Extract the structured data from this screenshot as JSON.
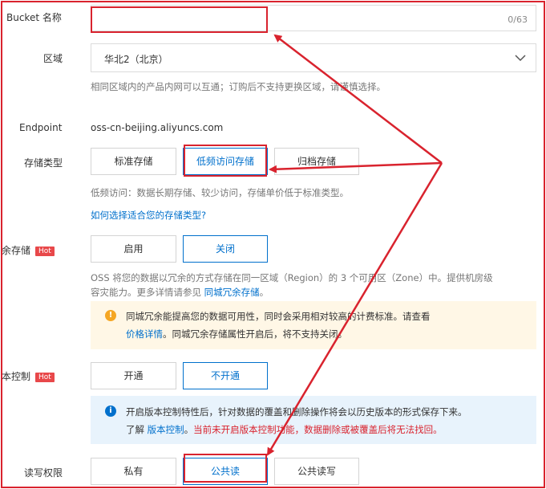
{
  "bucket": {
    "label": "Bucket 名称",
    "value": "",
    "counter": "0/63"
  },
  "region": {
    "label": "区域",
    "value": "华北2（北京）",
    "hint": "相同区域内的产品内网可以互通；订购后不支持更换区域，请谨慎选择。"
  },
  "endpoint": {
    "label": "Endpoint",
    "value": "oss-cn-beijing.aliyuncs.com"
  },
  "storage": {
    "label": "存储类型",
    "options": [
      "标准存储",
      "低频访问存储",
      "归档存储"
    ],
    "selected": "低频访问存储",
    "hint": "低频访问：数据长期存储、较少访问，存储单价低于标准类型。",
    "help_link": "如何选择适合您的存储类型?"
  },
  "redundancy": {
    "label": "余存储",
    "hot": "Hot",
    "options": [
      "启用",
      "关闭"
    ],
    "selected": "关闭",
    "desc_line1": "OSS 将您的数据以冗余的方式存储在同一区域（Region）的 3 个可用区（Zone）中。提供机房级",
    "desc_line2_prefix": "容灾能力。更多详情请参见",
    "desc_link": "同城冗余存储",
    "desc_line2_suffix": "。",
    "notice_line1": "同城冗余能提高您的数据可用性，同时会采用相对较高的计费标准。请查看",
    "notice_link": "价格详情",
    "notice_line2_suffix": "。同城冗余存储属性开启后，将不支持关闭。"
  },
  "versioning": {
    "label": "本控制",
    "hot": "Hot",
    "options": [
      "开通",
      "不开通"
    ],
    "selected": "不开通",
    "notice_line1": "开启版本控制特性后，针对数据的覆盖和删除操作将会以历史版本的形式保存下来。",
    "notice_line2_prefix": "了解",
    "notice_link": "版本控制",
    "notice_line2_suffix": "。",
    "notice_warning": "当前未开启版本控制功能，数据删除或被覆盖后将无法找回。"
  },
  "acl": {
    "label": "读写权限",
    "options": [
      "私有",
      "公共读",
      "公共读写"
    ],
    "selected": "公共读"
  },
  "icons": {
    "dropdown": "chevron-down-icon",
    "warning": "warning-icon",
    "info": "info-icon"
  },
  "colors": {
    "accent": "#0070cc",
    "annotation": "#d9232e",
    "hot": "#e8484a"
  }
}
